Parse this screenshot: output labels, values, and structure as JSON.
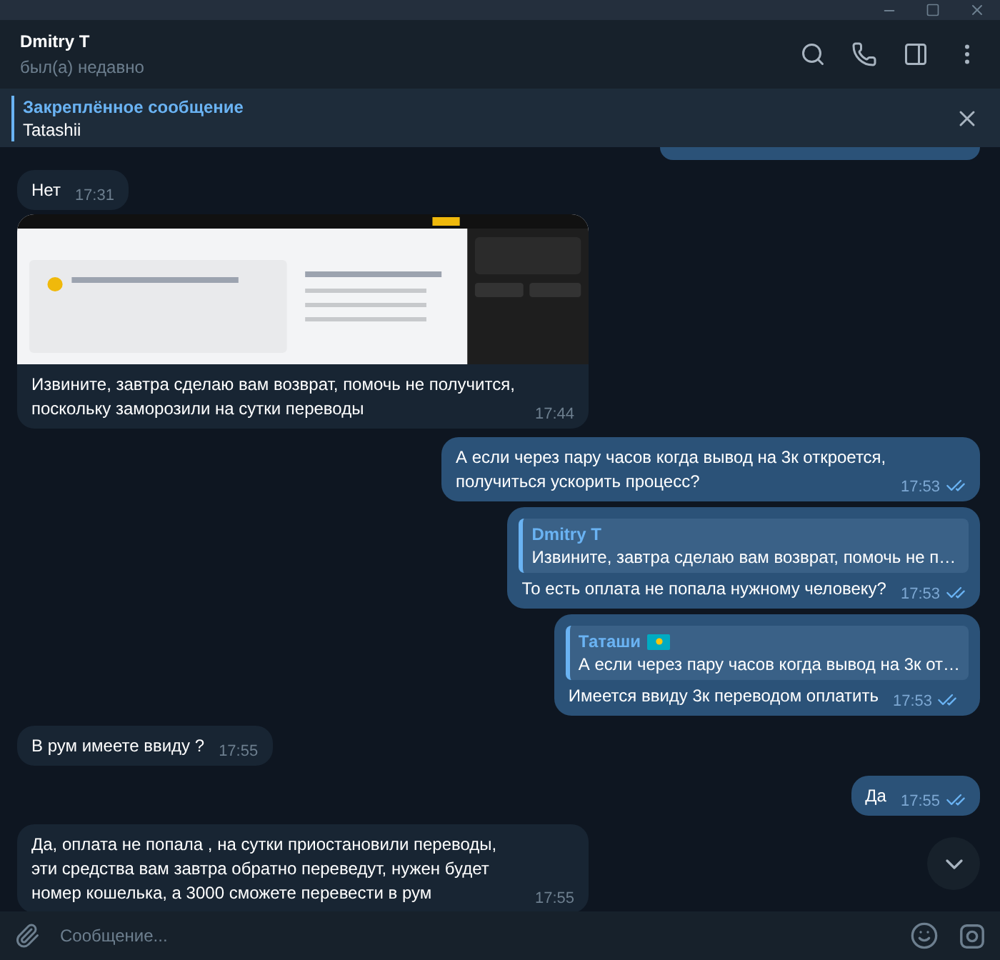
{
  "header": {
    "title": "Dmitry T",
    "status": "был(а) недавно"
  },
  "pinned": {
    "title": "Закреплённое сообщение",
    "text": "Tatashii"
  },
  "messages": [
    {
      "kind": "incoming",
      "text": "Нет",
      "time": "17:31"
    },
    {
      "kind": "incoming",
      "text": "Извините, завтра сделаю вам возврат, помочь не получится, поскольку заморозили на сутки переводы",
      "time": "17:44"
    },
    {
      "kind": "outgoing",
      "text": "А если через пару часов когда вывод на 3к откроется, получиться ускорить процесс?",
      "time": "17:53",
      "read": true
    },
    {
      "kind": "outgoing",
      "reply": {
        "author": "Dmitry T",
        "text": "Извините, завтра сделаю вам возврат, помочь не п…",
        "flag_icon": false
      },
      "text": "То есть оплата не попала нужному человеку?",
      "time": "17:53",
      "read": true
    },
    {
      "kind": "outgoing",
      "reply": {
        "author": "Таташи",
        "text": "А если через пару часов когда вывод на 3к от…",
        "flag_icon": true
      },
      "text": "Имеется ввиду 3к переводом оплатить",
      "time": "17:53",
      "read": true
    },
    {
      "kind": "incoming",
      "text": "В рум имеете ввиду ?",
      "time": "17:55"
    },
    {
      "kind": "outgoing",
      "text": "Да",
      "time": "17:55",
      "read": true
    },
    {
      "kind": "incoming",
      "text": "Да, оплата не попала , на сутки приостановили переводы, эти средства вам завтра обратно переведут, нужен будет номер кошелька, а 3000 сможете перевести в рум",
      "time": "17:55"
    }
  ],
  "composer": {
    "placeholder": "Сообщение..."
  }
}
